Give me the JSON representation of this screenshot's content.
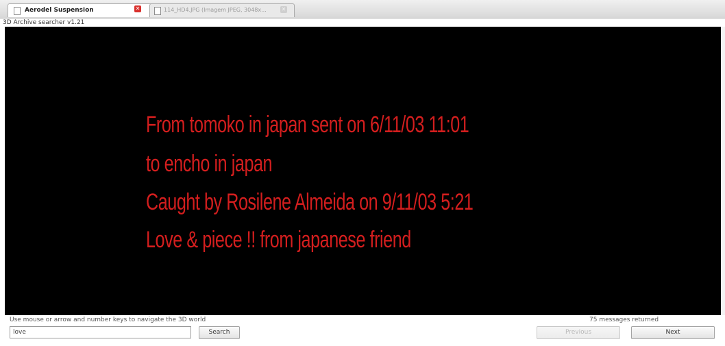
{
  "tabs": [
    {
      "label": "Aerodel Suspension",
      "active": true
    },
    {
      "label": "114_HD4.JPG (Imagem JPEG, 3048x...",
      "active": false
    }
  ],
  "app": {
    "subtitle": "3D Archive searcher v1.21"
  },
  "message": {
    "lines": [
      "From tomoko in japan sent on 6/11/03 11:01",
      "to encho in japan",
      "Caught by Rosilene Almeida on 9/11/03 5:21",
      "Love & piece !! from japanese friend"
    ],
    "color": "#d31e1e"
  },
  "footer": {
    "hint": "Use mouse or arrow and number keys to navigate the 3D world",
    "count": "75 messages returned",
    "search_value": "love",
    "search_label": "Search",
    "previous_label": "Previous",
    "next_label": "Next"
  },
  "colors": {
    "viewport_bg": "#000000",
    "close_icon": "#d9302c"
  }
}
